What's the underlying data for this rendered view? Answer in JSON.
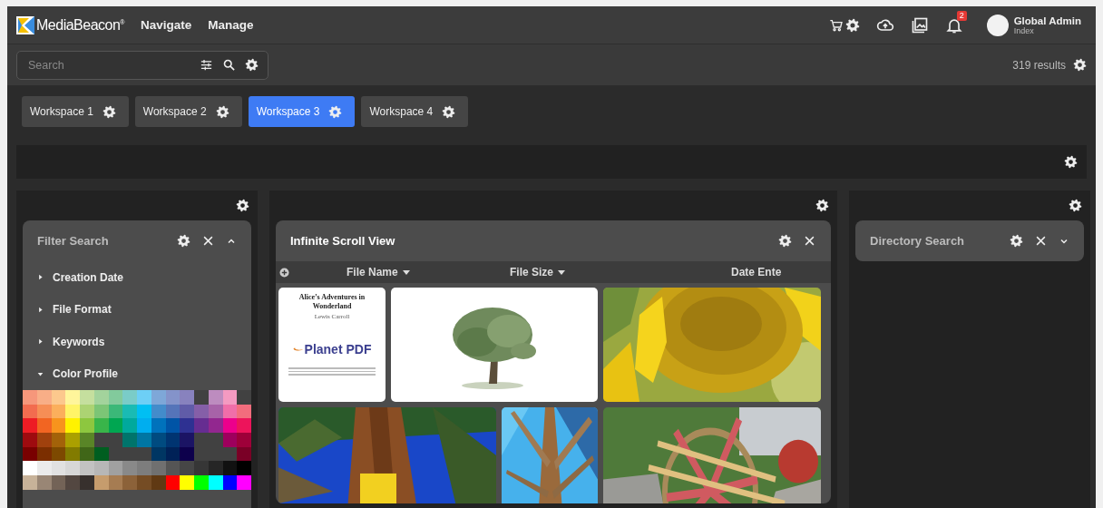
{
  "header": {
    "logo": "MediaBeacon$^{®}$",
    "nav": [
      "Navigate",
      "Manage"
    ],
    "notifications": {
      "count": "2"
    },
    "user": {
      "name": "Global Admin",
      "role": "Index"
    }
  },
  "search": {
    "placeholder": "Search",
    "results": "319 results"
  },
  "workspaces": [
    {
      "label": "Workspace 1",
      "selected": false
    },
    {
      "label": "Workspace 2",
      "selected": false
    },
    {
      "label": "Workspace 3",
      "selected": true
    },
    {
      "label": "Workspace 4",
      "selected": false
    }
  ],
  "filter_panel": {
    "title": "Filter Search",
    "items": [
      {
        "label": "Creation Date",
        "expanded": false
      },
      {
        "label": "File Format",
        "expanded": false
      },
      {
        "label": "Keywords",
        "expanded": false
      },
      {
        "label": "Color Profile",
        "expanded": true
      }
    ],
    "palette": [
      [
        {
          "color": "#f6977b"
        },
        {
          "color": "#f8ae87"
        },
        {
          "color": "#fcc88d"
        },
        {
          "color": "#fff59b"
        },
        {
          "color": "#c5df9e"
        },
        {
          "color": "#a3d39c"
        },
        {
          "color": "#82ca9c"
        },
        {
          "color": "#7accc8"
        },
        {
          "color": "#6dcff6"
        },
        {
          "color": "#7ea7d8"
        },
        {
          "color": "#8493ca"
        },
        {
          "color": "#8882be"
        },
        {
          "color": "#414141"
        },
        {
          "color": "#bd8cbf"
        },
        {
          "color": "#f49ac1"
        },
        {
          "color": "#414141"
        }
      ],
      [
        {
          "color": "#f26c4f"
        },
        {
          "color": "#f68e56"
        },
        {
          "color": "#fbaf5c"
        },
        {
          "color": "#fff467"
        },
        {
          "color": "#acd373"
        },
        {
          "color": "#7cc576"
        },
        {
          "color": "#3bb878"
        },
        {
          "color": "#1abbb4"
        },
        {
          "color": "#00bff3"
        },
        {
          "color": "#438ccb"
        },
        {
          "color": "#5574b9"
        },
        {
          "color": "#605ca8"
        },
        {
          "color": "#855fa8"
        },
        {
          "color": "#a763a8"
        },
        {
          "color": "#f06ea9"
        },
        {
          "color": "#f26d7d"
        }
      ],
      [
        {
          "color": "#ed1c24"
        },
        {
          "color": "#f26522"
        },
        {
          "color": "#f7941d"
        },
        {
          "color": "#fff200"
        },
        {
          "color": "#8dc73f"
        },
        {
          "color": "#39b54a"
        },
        {
          "color": "#00a651"
        },
        {
          "color": "#00a99d"
        },
        {
          "color": "#00aeef"
        },
        {
          "color": "#0072bc"
        },
        {
          "color": "#0054a6"
        },
        {
          "color": "#2e3192"
        },
        {
          "color": "#662d91"
        },
        {
          "color": "#92278f"
        },
        {
          "color": "#ec008c"
        },
        {
          "color": "#ed145b"
        }
      ],
      [
        {
          "color": "#9e0b0f"
        },
        {
          "color": "#a0410d"
        },
        {
          "color": "#a36209"
        },
        {
          "color": "#aba000"
        },
        {
          "color": "#598527"
        },
        {
          "color": "#414141"
        },
        {
          "color": "#414141"
        },
        {
          "color": "#00746b"
        },
        {
          "color": "#0076a3"
        },
        {
          "color": "#004b80"
        },
        {
          "color": "#003471"
        },
        {
          "color": "#1b1464"
        },
        {
          "color": "#414141"
        },
        {
          "color": "#414141"
        },
        {
          "color": "#9e005d"
        },
        {
          "color": "#9e0039"
        }
      ],
      [
        {
          "color": "#790000"
        },
        {
          "color": "#7b2e00"
        },
        {
          "color": "#7d4900"
        },
        {
          "color": "#827b00"
        },
        {
          "color": "#406618"
        },
        {
          "color": "#005e20"
        },
        {
          "color": "#414141"
        },
        {
          "color": "#414141"
        },
        {
          "color": "#414141"
        },
        {
          "color": "#003663"
        },
        {
          "color": "#002157"
        },
        {
          "color": "#0d004c"
        },
        {
          "color": "#414141"
        },
        {
          "color": "#414141"
        },
        {
          "color": "#414141"
        },
        {
          "color": "#7a0026"
        }
      ],
      [
        {
          "color": "#ffffff"
        },
        {
          "color": "#ebebeb"
        },
        {
          "color": "#e1e1e1"
        },
        {
          "color": "#d7d7d7"
        },
        {
          "color": "#c2c2c2"
        },
        {
          "color": "#b7b7b7"
        },
        {
          "color": "#a0a0a0"
        },
        {
          "color": "#898989"
        },
        {
          "color": "#7d7d7d"
        },
        {
          "color": "#707070"
        },
        {
          "color": "#555555"
        },
        {
          "color": "#464646"
        },
        {
          "color": "#363636"
        },
        {
          "color": "#262626"
        },
        {
          "color": "#111111"
        },
        {
          "color": "#000000"
        }
      ],
      [
        {
          "color": "#c7b299"
        },
        {
          "color": "#998675"
        },
        {
          "color": "#736357"
        },
        {
          "color": "#534741"
        },
        {
          "color": "#37302d"
        },
        {
          "color": "#c69c6d"
        },
        {
          "color": "#a67c52"
        },
        {
          "color": "#8c6239"
        },
        {
          "color": "#754c24"
        },
        {
          "color": "#603913"
        },
        {
          "color": "#ff0000"
        },
        {
          "color": "#ffff00"
        },
        {
          "color": "#00ff00"
        },
        {
          "color": "#00ffff"
        },
        {
          "color": "#0000ff"
        },
        {
          "color": "#ff00ff"
        }
      ]
    ]
  },
  "scroll_view": {
    "title": "Infinite Scroll View",
    "columns": [
      "File Name",
      "File Size",
      "Date Ente"
    ],
    "thumbnails": [
      {
        "kind": "document",
        "title": "Alice’s Adventures in Wonderland",
        "author": "Lewis Carroll",
        "brand": "Planet PDF"
      },
      {
        "kind": "picture"
      },
      {
        "kind": "picture"
      },
      {
        "kind": "picture"
      },
      {
        "kind": "picture"
      },
      {
        "kind": "picture"
      }
    ]
  },
  "directory_panel": {
    "title": "Directory Search"
  }
}
